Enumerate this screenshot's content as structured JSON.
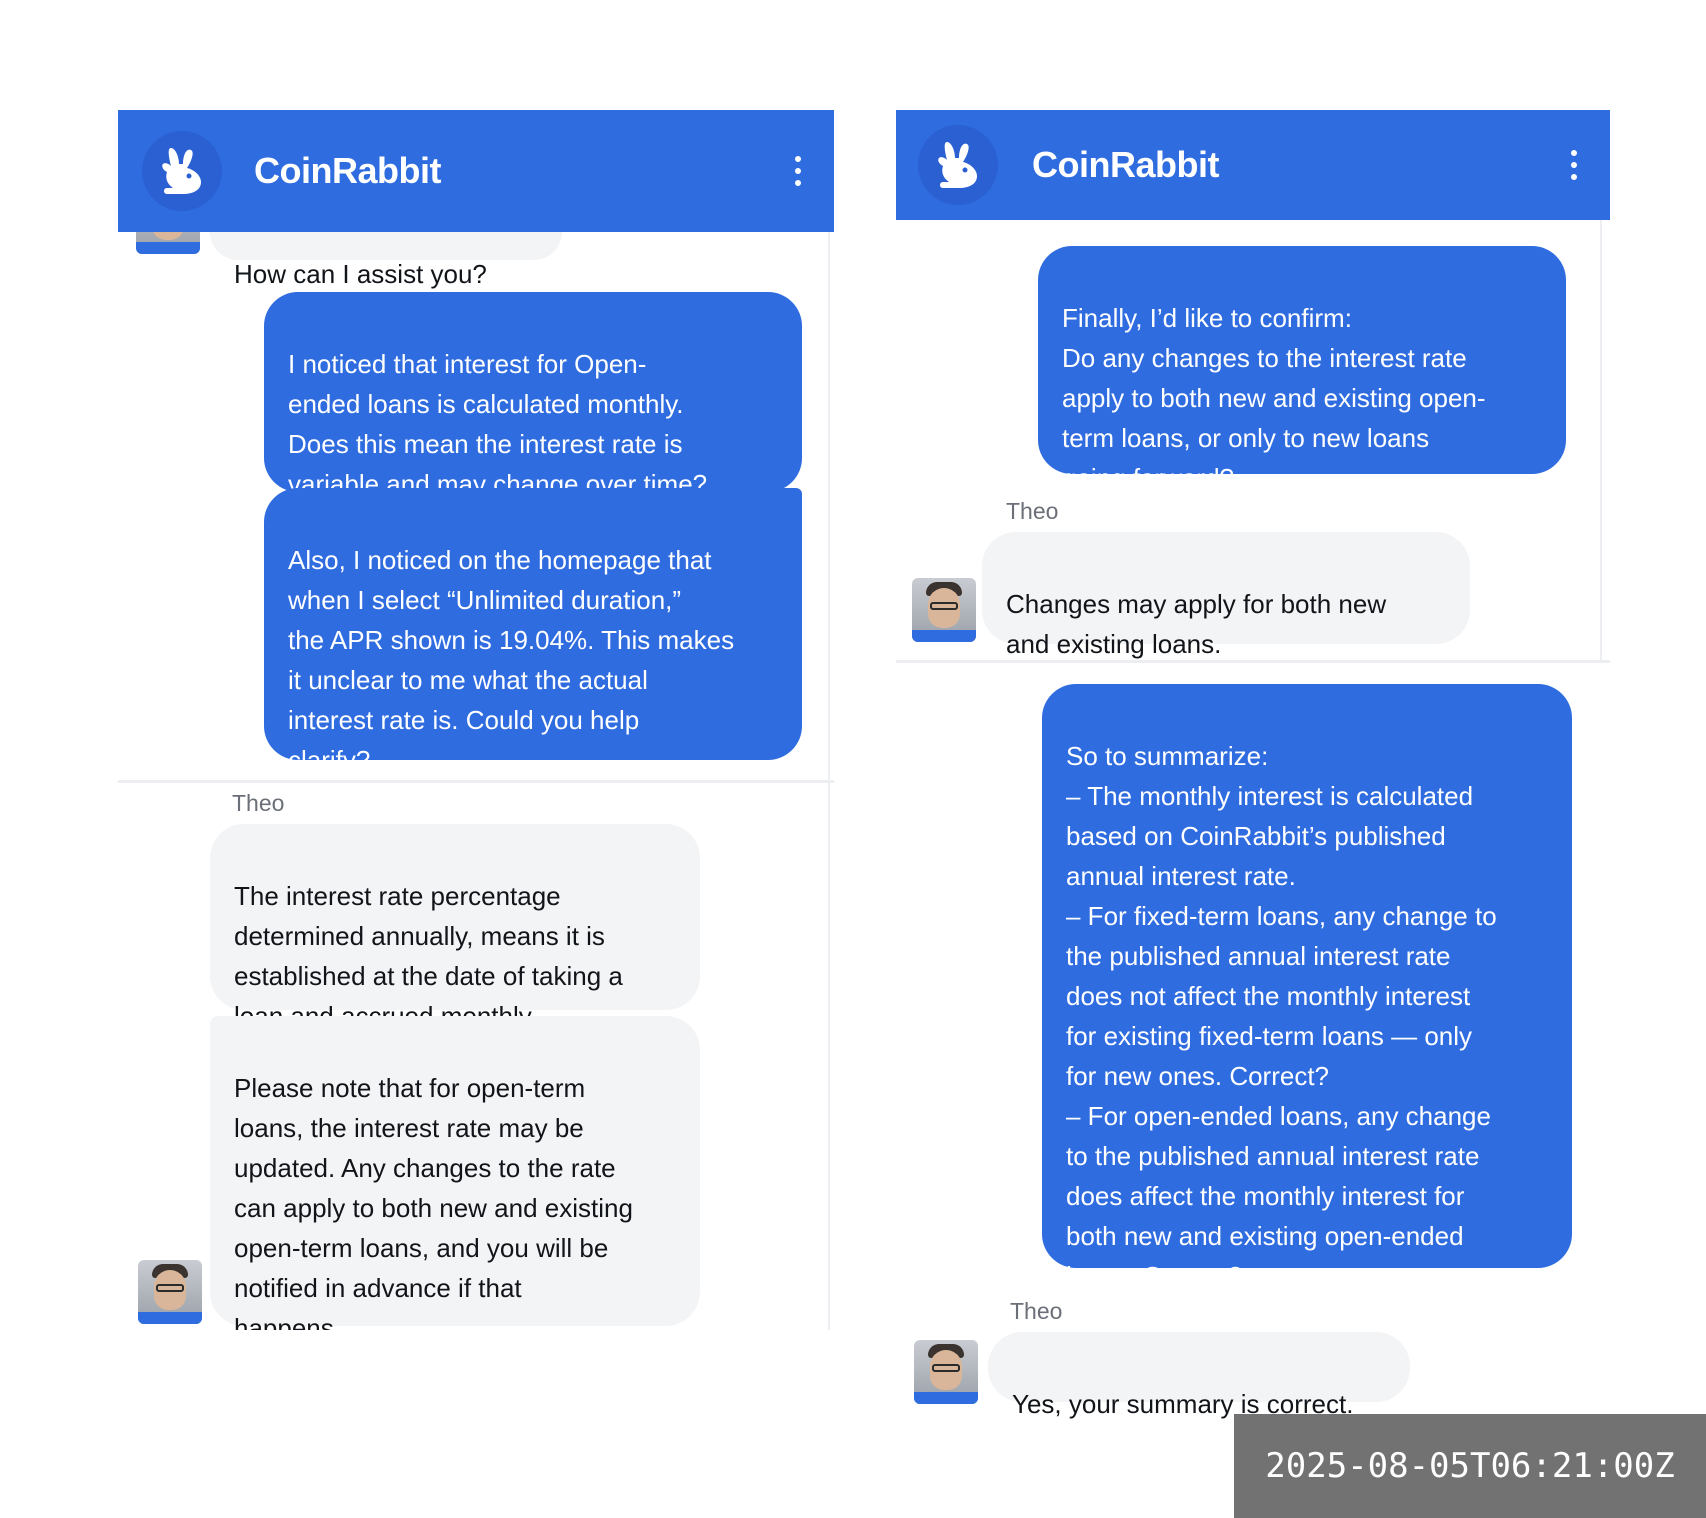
{
  "left_panel": {
    "header": {
      "brand": "CoinRabbit",
      "logo_icon": "rabbit-logo-icon",
      "menu_icon": "more-vertical-icon"
    },
    "messages": {
      "agent_partial": "How can I assist you?",
      "user_1": "I noticed that interest for Open-\nended loans is calculated monthly.\nDoes this mean the interest rate is\nvariable and may change over time?",
      "user_2": "Also, I noticed on the homepage that\nwhen I select “Unlimited duration,”\nthe APR shown is 19.04%. This makes\nit unclear to me what the actual\ninterest rate is. Could you help\nclarify?",
      "sender": "Theo",
      "agent_1": "The interest rate percentage\ndetermined annually, means it is\nestablished at the date of taking a\nloan and accrued monthly.",
      "agent_2": "Please note that for open-term\nloans, the interest rate may be\nupdated. Any changes to the rate\ncan apply to both new and existing\nopen-term loans, and you will be\nnotified in advance if that\nhappens."
    }
  },
  "right_panel": {
    "header": {
      "brand": "CoinRabbit",
      "logo_icon": "rabbit-logo-icon",
      "menu_icon": "more-vertical-icon"
    },
    "messages": {
      "user_1": "Finally, I’d like to confirm:\nDo any changes to the interest rate\napply to both new and existing open-\nterm loans, or only to new loans\ngoing forward?",
      "sender_1": "Theo",
      "agent_1": "Changes may apply for both new\nand existing loans.",
      "user_2": "So to summarize:\n– The monthly interest is calculated\nbased on CoinRabbit’s published\nannual interest rate.\n– For fixed-term loans, any change to\nthe published annual interest rate\ndoes not affect the monthly interest\nfor existing fixed-term loans — only\nfor new ones. Correct?\n– For open-ended loans, any change\nto the published annual interest rate\ndoes affect the monthly interest for\nboth new and existing open-ended\nloans. Correct?",
      "sender_2": "Theo",
      "agent_2": "Yes, your summary is correct."
    }
  },
  "timestamp": "2025-08-05T06:21:00Z",
  "colors": {
    "accent": "#2f6ce0",
    "agent_bubble": "#f3f4f6",
    "stamp_bg": "#727272"
  }
}
